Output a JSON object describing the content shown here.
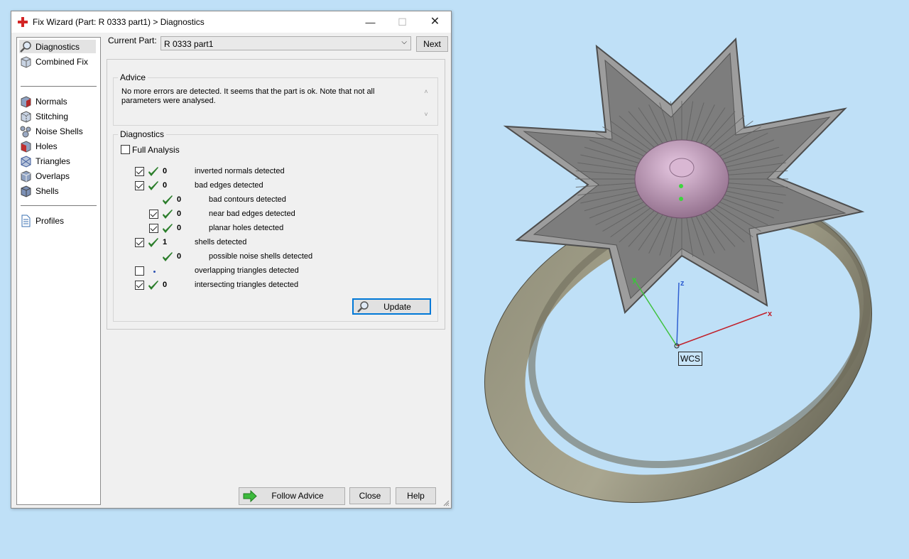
{
  "window": {
    "title": "Fix Wizard (Part: R 0333 part1) > Diagnostics",
    "minimize": "—",
    "maximize": "☐",
    "close": "✕"
  },
  "nav": {
    "items": [
      {
        "label": "Diagnostics",
        "icon": "magnifier-icon"
      },
      {
        "label": "Combined Fix",
        "icon": "cube-icon"
      },
      {
        "label": "Normals",
        "icon": "normals-cube-icon"
      },
      {
        "label": "Stitching",
        "icon": "stitching-cube-icon"
      },
      {
        "label": "Noise Shells",
        "icon": "noise-shells-icon"
      },
      {
        "label": "Holes",
        "icon": "holes-cube-icon"
      },
      {
        "label": "Triangles",
        "icon": "triangles-cube-icon"
      },
      {
        "label": "Overlaps",
        "icon": "overlaps-cube-icon"
      },
      {
        "label": "Shells",
        "icon": "shells-cube-icon"
      },
      {
        "label": "Profiles",
        "icon": "document-icon"
      }
    ]
  },
  "current_part": {
    "label": "Current Part:",
    "value": "R 0333 part1",
    "next_label": "Next"
  },
  "advice": {
    "legend": "Advice",
    "text": "No more errors are detected. It seems that the part is ok. Note that not all parameters were analysed."
  },
  "diagnostics": {
    "legend": "Diagnostics",
    "full_analysis_label": "Full Analysis",
    "full_analysis_checked": false,
    "rows": [
      {
        "checked": true,
        "has_checkbox": true,
        "status": "ok",
        "count": "0",
        "text": "inverted normals detected",
        "indent": 0
      },
      {
        "checked": true,
        "has_checkbox": true,
        "status": "ok",
        "count": "0",
        "text": "bad edges detected",
        "indent": 0
      },
      {
        "checked": false,
        "has_checkbox": false,
        "status": "ok",
        "count": "0",
        "text": "bad contours detected",
        "indent": 1
      },
      {
        "checked": true,
        "has_checkbox": true,
        "status": "ok",
        "count": "0",
        "text": "near bad edges detected",
        "indent": 1
      },
      {
        "checked": true,
        "has_checkbox": true,
        "status": "ok",
        "count": "0",
        "text": "planar holes detected",
        "indent": 1
      },
      {
        "checked": true,
        "has_checkbox": true,
        "status": "ok",
        "count": "1",
        "text": "shells detected",
        "indent": 0
      },
      {
        "checked": false,
        "has_checkbox": false,
        "status": "ok",
        "count": "0",
        "text": "possible noise shells detected",
        "indent": 1
      },
      {
        "checked": false,
        "has_checkbox": true,
        "status": "not-analysed",
        "count": "",
        "text": "overlapping triangles detected",
        "indent": 0
      },
      {
        "checked": true,
        "has_checkbox": true,
        "status": "ok",
        "count": "0",
        "text": "intersecting triangles detected",
        "indent": 0
      }
    ],
    "update_label": "Update"
  },
  "footer": {
    "follow_advice_label": "Follow Advice",
    "close_label": "Close",
    "help_label": "Help"
  },
  "viewport": {
    "wcs_label": "WCS",
    "axis_x": "x",
    "axis_y": "y",
    "axis_z": "z"
  },
  "colors": {
    "ok_check": "#2a7d2a",
    "viewport_bg": "#bfe0f7",
    "selection": "#0078d7"
  }
}
